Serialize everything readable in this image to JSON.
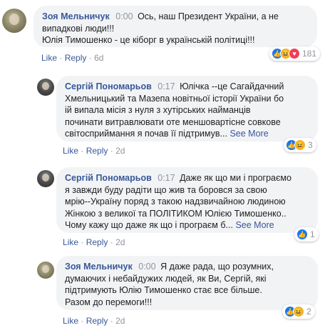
{
  "comments": [
    {
      "author": "Зоя Мельничук",
      "time": "0:00",
      "lines": [
        "Ось, наш Президент України, а не",
        "випадкові люди!!!",
        "Юлія Тимошенко - це кіборг в українській політиці!!!"
      ],
      "actions": {
        "like": "Like",
        "reply": "Reply",
        "ago": "6d"
      },
      "reactions": {
        "icons": [
          "like",
          "haha",
          "love"
        ],
        "count": "181"
      }
    },
    {
      "author": "Сергій Пономарьов",
      "time": "0:17",
      "lines": [
        "Юлічка --це Сагайдачний",
        "Хмельницький та Мазепа новітньої історії України бо",
        "ій випала місія з нуля з хутірських найманців",
        "починати витравлювати оте меншовартісне совкове",
        "світосприймання я почав її підтримув..."
      ],
      "see_more": "See More",
      "actions": {
        "like": "Like",
        "reply": "Reply",
        "ago": "2d"
      },
      "reactions": {
        "icons": [
          "like",
          "haha"
        ],
        "count": "3"
      }
    },
    {
      "author": "Сергій Пономарьов",
      "time": "0:17",
      "lines": [
        "Даже як що ми і програємо",
        "я завжди буду радіти що жив та боровся за свою",
        "мрію--Україну поряд з такою надзвичайною людиною",
        "Жінкою з великої та ПОЛІТИКОМ Юлією Тимошенко..",
        "Чому кажу що даже як що і програєм б..."
      ],
      "see_more": "See More",
      "actions": {
        "like": "Like",
        "reply": "Reply",
        "ago": "2d"
      },
      "reactions": {
        "icons": [
          "like"
        ],
        "count": "1"
      }
    },
    {
      "author": "Зоя Мельничук",
      "time": "0:00",
      "lines": [
        "Я даже рада, що розумних,",
        "думаючих і небайдужих людей, як Ви, Сергій, які",
        "підтримують Юлію Тимошенко стає все більше.",
        "Разом до перемоги!!!"
      ],
      "actions": {
        "like": "Like",
        "reply": "Reply",
        "ago": "2d"
      },
      "reactions": {
        "icons": [
          "like",
          "haha"
        ],
        "count": "2"
      }
    }
  ],
  "separator": "·",
  "icon_glyphs": {
    "like": "👍",
    "haha": "😆",
    "love": "♥"
  }
}
